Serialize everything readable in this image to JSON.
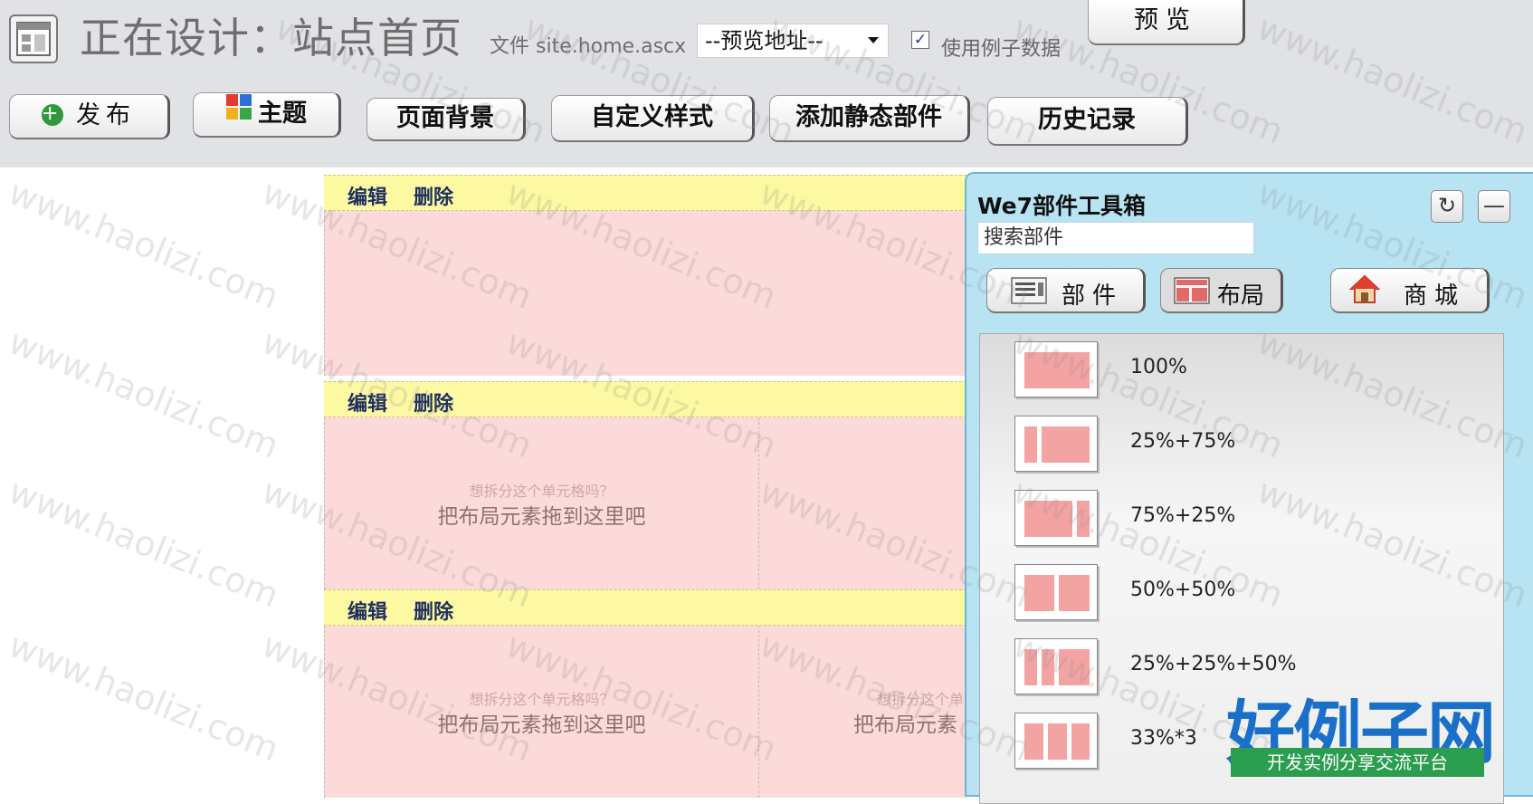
{
  "header": {
    "title_prefix": "正在设计：",
    "title_page": "站点首页",
    "file_info": "文件 site.home.ascx",
    "preview_address": "--预览地址--",
    "use_sample_label": "使用例子数据",
    "use_sample_checked": true,
    "preview_button": "预览"
  },
  "toolbar": {
    "publish": "发布",
    "theme": "主题",
    "page_background": "页面背景",
    "custom_style": "自定义样式",
    "add_static_widget": "添加静态部件",
    "history": "历史记录"
  },
  "canvas": {
    "edit": "编辑",
    "delete": "删除",
    "split_hint": "想拆分这个单元格吗？",
    "drop_hint": "把布局元素拖到这里吧",
    "drop_hint_partial": "把布局元素"
  },
  "toolbox": {
    "title": "We7部件工具箱",
    "search_placeholder": "搜索部件",
    "tabs": {
      "parts": "部件",
      "layout": "布局",
      "shop": "商城"
    },
    "active_tab": "layout",
    "layouts": [
      "100%",
      "25%+75%",
      "75%+25%",
      "50%+50%",
      "25%+25%+50%",
      "33%*3"
    ]
  },
  "watermark": "www.haolizi.com",
  "brand": {
    "logo": "好例子网",
    "tagline": "开发实例分享交流平台"
  },
  "colors": {
    "header_bg": "#e1e2e6",
    "row_bar": "#fdf9a2",
    "cell_bg": "#fcdada",
    "toolbox_bg": "#b8e3f3",
    "layout_block": "#f4a3a3",
    "brand_blue": "#1a70c8",
    "brand_green": "#2a9d4e"
  }
}
